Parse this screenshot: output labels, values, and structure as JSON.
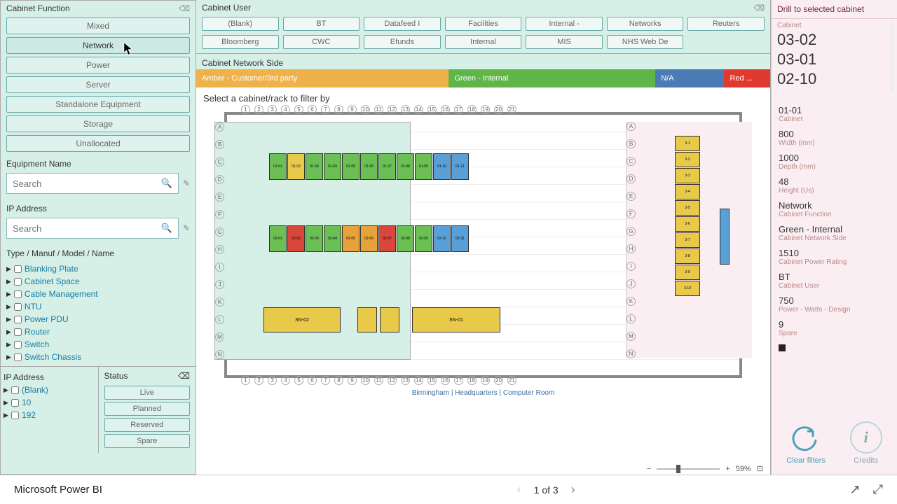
{
  "left": {
    "cabinet_function": {
      "title": "Cabinet Function",
      "items": [
        "Mixed",
        "Network",
        "Power",
        "Server",
        "Standalone Equipment",
        "Storage",
        "Unallocated"
      ]
    },
    "equipment_name": {
      "title": "Equipment Name",
      "placeholder": "Search"
    },
    "ip_address": {
      "title": "IP Address",
      "placeholder": "Search"
    },
    "tree": {
      "title": "Type / Manuf / Model / Name",
      "items": [
        "Blanking Plate",
        "Cabinet Space",
        "Cable Management",
        "NTU",
        "Power PDU",
        "Router",
        "Switch",
        "Switch Chassis"
      ]
    },
    "ip_list": {
      "title": "IP Address",
      "items": [
        "(Blank)",
        "10",
        "192"
      ]
    },
    "status": {
      "title": "Status",
      "items": [
        "Live",
        "Planned",
        "Reserved",
        "Spare"
      ]
    }
  },
  "mid": {
    "cabinet_user": {
      "title": "Cabinet User",
      "items": [
        "(Blank)",
        "BT",
        "Datafeed I",
        "Facilities",
        "Internal -",
        "Networks",
        "Reuters",
        "Bloomberg",
        "CWC",
        "Efunds",
        "Internal",
        "MIS",
        "NHS Web De"
      ]
    },
    "netside": {
      "title": "Cabinet Network Side",
      "amber": "Amber - Customer/3rd party",
      "green": "Green - Internal",
      "na": "N/A",
      "red": "Red ..."
    },
    "select_label": "Select a cabinet/rack to filter by",
    "axis_h": [
      "1",
      "2",
      "3",
      "4",
      "5",
      "6",
      "7",
      "8",
      "9",
      "10",
      "11",
      "12",
      "13",
      "14",
      "15",
      "16",
      "17",
      "18",
      "19",
      "20",
      "21"
    ],
    "axis_v": [
      "A",
      "B",
      "C",
      "D",
      "E",
      "F",
      "G",
      "H",
      "I",
      "J",
      "K",
      "L",
      "M",
      "N"
    ],
    "row1": [
      {
        "c": "g",
        "t": "01-01"
      },
      {
        "c": "y",
        "t": "01-02"
      },
      {
        "c": "g",
        "t": "01-03"
      },
      {
        "c": "g",
        "t": "01-04"
      },
      {
        "c": "g",
        "t": "01-05"
      },
      {
        "c": "g",
        "t": "01-06"
      },
      {
        "c": "g",
        "t": "01-07"
      },
      {
        "c": "g",
        "t": "01-08"
      },
      {
        "c": "g",
        "t": "01-09"
      },
      {
        "c": "b",
        "t": "01-10"
      },
      {
        "c": "b",
        "t": "01-11"
      }
    ],
    "row2": [
      {
        "c": "g",
        "t": "02-01"
      },
      {
        "c": "r",
        "t": "02-02"
      },
      {
        "c": "g",
        "t": "02-03"
      },
      {
        "c": "g",
        "t": "02-04"
      },
      {
        "c": "o",
        "t": "02-05"
      },
      {
        "c": "o",
        "t": "02-06"
      },
      {
        "c": "r",
        "t": "02-07"
      },
      {
        "c": "g",
        "t": "02-08"
      },
      {
        "c": "g",
        "t": "02-09"
      },
      {
        "c": "b",
        "t": "02-10"
      },
      {
        "c": "b",
        "t": "02-11"
      }
    ],
    "rack_col": [
      {
        "c": "y",
        "t": "3-1"
      },
      {
        "c": "y",
        "t": "3-2"
      },
      {
        "c": "y",
        "t": "3-3"
      },
      {
        "c": "y",
        "t": "3-4"
      },
      {
        "c": "y",
        "t": "3-5"
      },
      {
        "c": "y",
        "t": "3-6"
      },
      {
        "c": "y",
        "t": "3-7"
      },
      {
        "c": "y",
        "t": "3-8"
      },
      {
        "c": "y",
        "t": "3-9"
      },
      {
        "c": "y",
        "t": "3-10"
      }
    ],
    "big1": "SN-02",
    "big2": "SN-01",
    "caption": "Birmingham | Headquarters | Computer Room",
    "zoom": "59%"
  },
  "right": {
    "title": "Drill to selected cabinet",
    "sub": "Cabinet",
    "list": [
      "03-02",
      "03-01",
      "02-10"
    ],
    "details": [
      {
        "v": "01-01",
        "l": "Cabinet"
      },
      {
        "v": "800",
        "l": "Width (mm)"
      },
      {
        "v": "1000",
        "l": "Depth (mm)"
      },
      {
        "v": "48",
        "l": "Height (Us)"
      },
      {
        "v": "Network",
        "l": "Cabinet Function"
      },
      {
        "v": "Green - Internal",
        "l": "Cabinet Network Side"
      },
      {
        "v": "1510",
        "l": "Cabinet Power Rating"
      },
      {
        "v": "BT",
        "l": "Cabinet User"
      },
      {
        "v": "750",
        "l": "Power - Watts - Design"
      },
      {
        "v": "9",
        "l": "Spare"
      }
    ],
    "clear": "Clear filters",
    "credits": "Credits"
  },
  "footer": {
    "brand": "Microsoft Power BI",
    "page": "1 of 3"
  }
}
